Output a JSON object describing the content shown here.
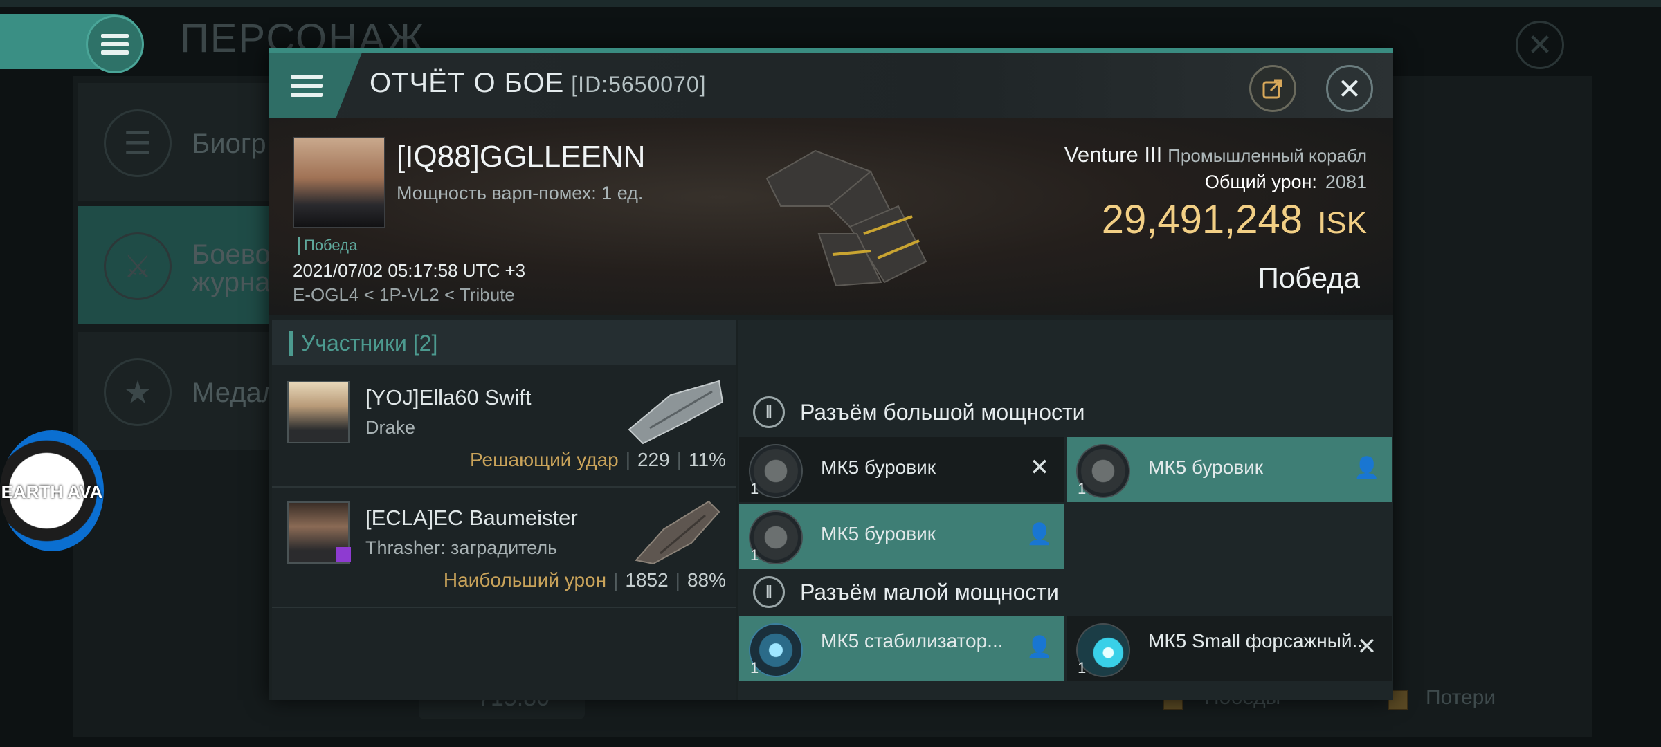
{
  "background": {
    "title": "ПЕРСОНАЖ",
    "sidebar": [
      {
        "label": "Биогр",
        "icon": "list-icon"
      },
      {
        "label": "Боево журна",
        "icon": "crossed-swords-icon"
      },
      {
        "label": "Медал",
        "icon": "star-icon"
      }
    ],
    "globe_badge": "EARTH AVA",
    "bottom_value": "715.80",
    "legend": {
      "wins": "Победы",
      "losses": "Потери"
    }
  },
  "report": {
    "title": "ОТЧЁТ О БОЕ",
    "report_id": "[ID:5650070]",
    "victim": {
      "name": "[IQ88]GGLLEENN",
      "warp_disruption": "Мощность варп-помех: 1 ед.",
      "tag": "Победа",
      "datetime": "2021/07/02 05:17:58 UTC +3",
      "location": "E-OGL4 < 1P-VL2 < Tribute"
    },
    "ship": {
      "name": "Venture III",
      "class": "Промышленный корабл",
      "damage_label": "Общий урон:",
      "damage_value": "2081",
      "isk_value": "29,491,248",
      "isk_unit": "ISK",
      "result": "Победа"
    },
    "participants": {
      "title": "Участники [2]",
      "items": [
        {
          "name": "[YOJ]Ella60 Swift",
          "ship": "Drake",
          "role": "Решающий удар",
          "damage": "229",
          "percent": "11%"
        },
        {
          "name": "[ECLA]EC Baumeister",
          "ship": "Thrasher: заградитель",
          "role": "Наибольший урон",
          "damage": "1852",
          "percent": "88%"
        }
      ]
    },
    "fittings": {
      "high_slot_title": "Разъём большой мощности",
      "mid_slot_title": "Разъём малой мощности",
      "high": [
        {
          "name": "МК5 буровик",
          "qty": "1",
          "status": "destroyed"
        },
        {
          "name": "МК5 буровик",
          "qty": "1",
          "status": "dropped"
        },
        {
          "name": "МК5 буровик",
          "qty": "1",
          "status": "dropped"
        }
      ],
      "mid": [
        {
          "name": "МК5 стабилизатор...",
          "qty": "1",
          "status": "dropped"
        },
        {
          "name": "МК5 Small форсажный...",
          "qty": "1",
          "status": "destroyed"
        }
      ]
    }
  }
}
